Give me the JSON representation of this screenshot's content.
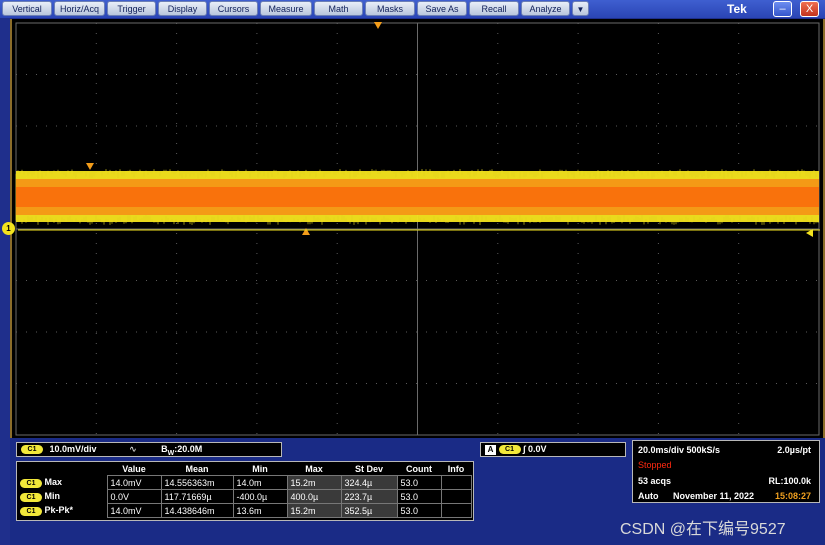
{
  "menu": {
    "items": [
      "Vertical",
      "Horiz/Acq",
      "Trigger",
      "Display",
      "Cursors",
      "Measure",
      "Math",
      "Masks",
      "Save As",
      "Recall",
      "Analyze"
    ],
    "more_label": "▼",
    "brand": "Tek",
    "minimize_label": "–",
    "close_label": "X"
  },
  "scope": {
    "channel_marker": "1",
    "colors": {
      "grid": "#5a5a5a",
      "trace_outer": "#f3e31e",
      "trace_inner": "#f47a12",
      "trace_core": "#ff2a00",
      "marker": "#f39c1a"
    }
  },
  "channel": {
    "badge": "C1",
    "scale": "10.0mV/div",
    "coupling_icon": "ac-wave-icon",
    "bandwidth_prefix": "B",
    "bandwidth_sub": "W",
    "bandwidth_value": ":20.0M"
  },
  "measurements": {
    "headers": [
      "Value",
      "Mean",
      "Min",
      "Max",
      "St Dev",
      "Count",
      "Info"
    ],
    "rows": [
      {
        "badge": "C1",
        "name": "Max",
        "value": "14.0mV",
        "mean": "14.556363m",
        "min": "14.0m",
        "max": "15.2m",
        "stdev": "324.4µ",
        "count": "53.0",
        "info": ""
      },
      {
        "badge": "C1",
        "name": "Min",
        "value": "0.0V",
        "mean": "117.71669µ",
        "min": "-400.0µ",
        "max": "400.0µ",
        "stdev": "223.7µ",
        "count": "53.0",
        "info": ""
      },
      {
        "badge": "C1",
        "name": "Pk-Pk*",
        "value": "14.0mV",
        "mean": "14.438646m",
        "min": "13.6m",
        "max": "15.2m",
        "stdev": "352.5µ",
        "count": "53.0",
        "info": ""
      }
    ]
  },
  "trigger": {
    "mode_badge": "A",
    "source_badge": "C1",
    "level": "0.0V",
    "slope_icon": "rising-edge-icon"
  },
  "acquisition": {
    "timebase": "20.0ms/div 500kS/s",
    "resolution": "2.0µs/pt",
    "status": "Stopped",
    "acqs": "53 acqs",
    "record_length": "RL:100.0k",
    "trigger_mode": "Auto",
    "date": "November 11, 2022",
    "time": "15:08:27",
    "status_color": "#ff2a10",
    "time_color": "#f0a020"
  },
  "watermark": "CSDN @在下编号9527"
}
